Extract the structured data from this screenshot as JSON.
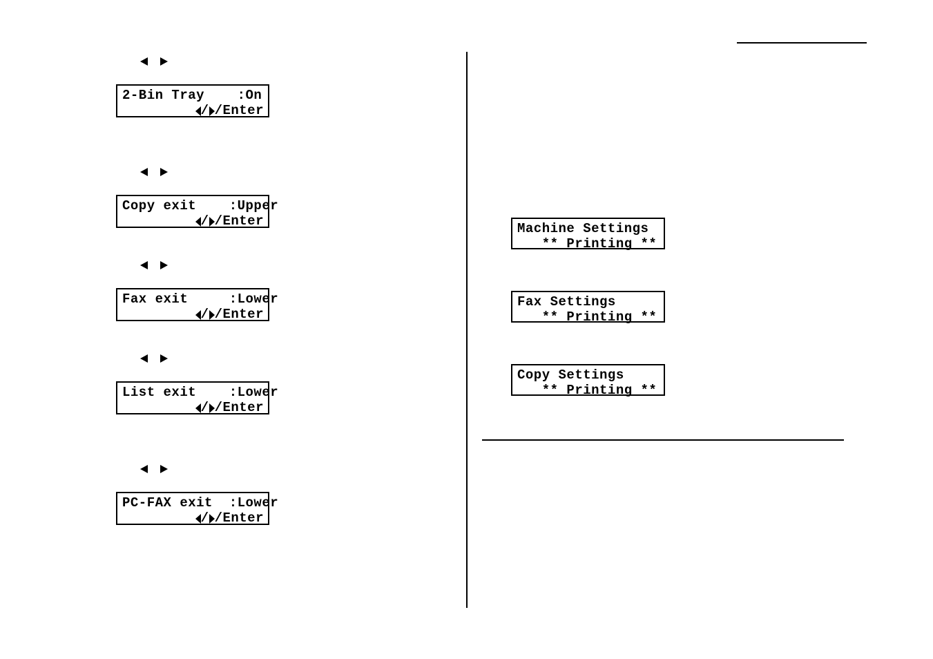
{
  "page": {
    "background": "#ffffff",
    "ink": "#000000"
  },
  "rules": {
    "top_right": "horizontal-rule",
    "vertical_divider": "vertical-rule",
    "mid_right": "horizontal-rule"
  },
  "left_column": {
    "steps": [
      {
        "nav_hint": {
          "left": "◄",
          "right": "►"
        },
        "lcd": {
          "label": "2-Bin Tray",
          "value": ":On",
          "line1": "2-Bin Tray    :On",
          "nav_line_suffix": "/Enter"
        }
      },
      {
        "nav_hint": {
          "left": "◄",
          "right": "►"
        },
        "lcd": {
          "label": "Copy exit",
          "value": ":Upper",
          "line1": "Copy exit    :Upper",
          "nav_line_suffix": "/Enter"
        }
      },
      {
        "nav_hint": {
          "left": "◄",
          "right": "►"
        },
        "lcd": {
          "label": "Fax exit",
          "value": ":Lower",
          "line1": "Fax exit     :Lower",
          "nav_line_suffix": "/Enter"
        }
      },
      {
        "nav_hint": {
          "left": "◄",
          "right": "►"
        },
        "lcd": {
          "label": "List exit",
          "value": ":Lower",
          "line1": "List exit    :Lower",
          "nav_line_suffix": "/Enter"
        }
      },
      {
        "nav_hint": {
          "left": "◄",
          "right": "►"
        },
        "lcd": {
          "label": "PC-FAX exit",
          "value": ":Lower",
          "line1": "PC-FAX exit  :Lower",
          "nav_line_suffix": "/Enter"
        }
      }
    ]
  },
  "right_column": {
    "status_displays": [
      {
        "line1": "Machine Settings",
        "line2": "   ** Printing **"
      },
      {
        "line1": "Fax Settings",
        "line2": "   ** Printing **"
      },
      {
        "line1": "Copy Settings",
        "line2": "   ** Printing **"
      }
    ]
  }
}
